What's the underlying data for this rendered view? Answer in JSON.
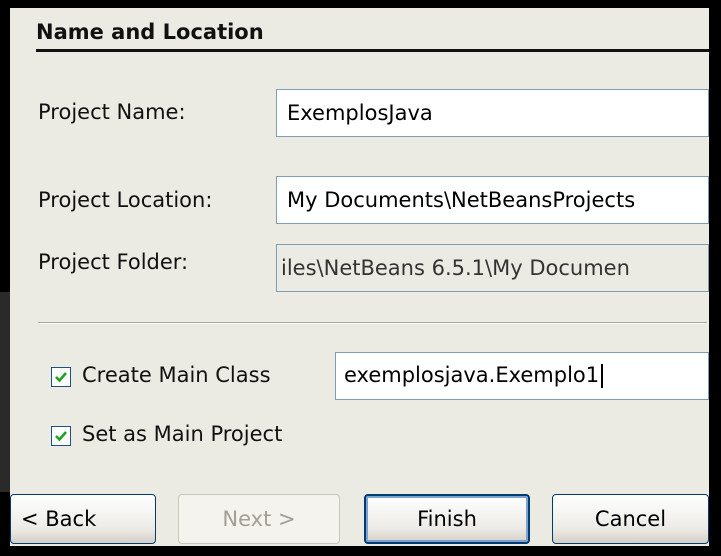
{
  "section": {
    "title": "Name and Location"
  },
  "form": {
    "project_name_label": "Project Name:",
    "project_name_value": "ExemplosJava",
    "project_location_label": "Project Location:",
    "project_location_value": "My Documents\\NetBeansProjects",
    "project_folder_label": "Project Folder:",
    "project_folder_value": "iles\\NetBeans 6.5.1\\My Documen"
  },
  "options": {
    "create_main_class_label": "Create Main Class",
    "create_main_class_checked": true,
    "main_class_value": "exemplosjava.Exemplo1",
    "set_main_project_label": "Set as Main Project",
    "set_main_project_checked": true
  },
  "buttons": {
    "back": "< Back",
    "next": "Next >",
    "finish": "Finish",
    "cancel": "Cancel"
  },
  "colors": {
    "accent": "#003c74",
    "checkmark": "#21a121",
    "field_border": "#7f9db9"
  }
}
